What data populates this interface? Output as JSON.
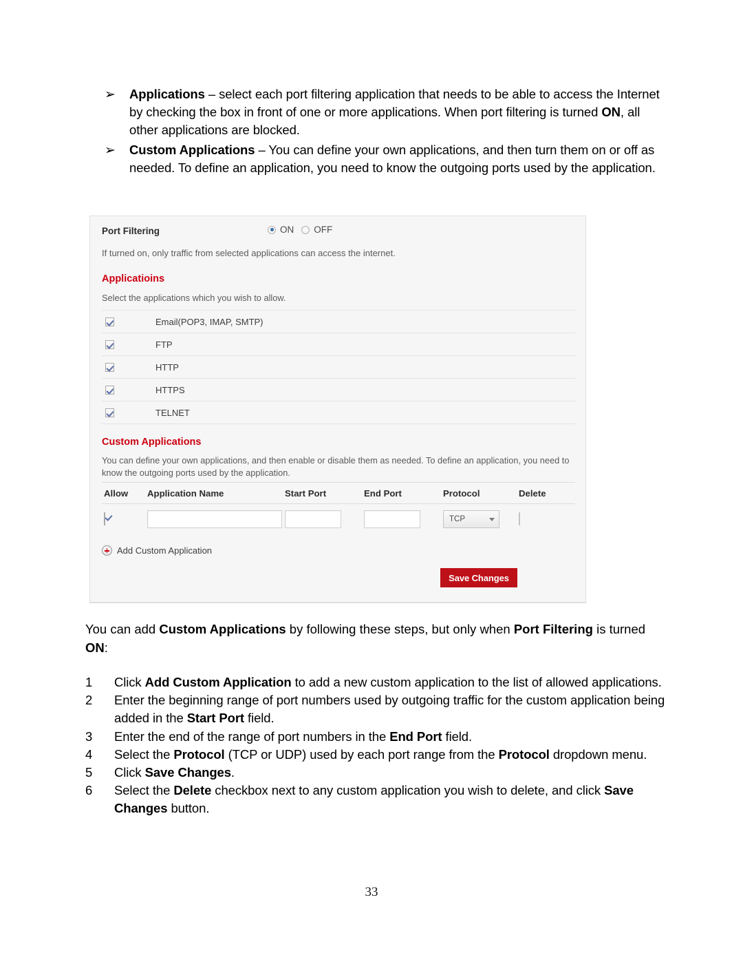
{
  "document": {
    "page_number": "33",
    "intro_bullets": [
      {
        "marker": "➢",
        "segments": [
          {
            "text": "Applications",
            "bold": true
          },
          {
            "text": " – select each port filtering application that needs to be able to access the Internet by checking the box in front of one or more applications. When port filtering is turned ",
            "bold": false
          },
          {
            "text": "ON",
            "bold": true
          },
          {
            "text": ", all other applications are blocked.",
            "bold": false
          }
        ]
      },
      {
        "marker": "➢",
        "segments": [
          {
            "text": "Custom Applications",
            "bold": true
          },
          {
            "text": " – You can define your own applications, and then turn them on or off as needed. To define an application, you need to know the outgoing ports used by the application.",
            "bold": false
          }
        ]
      }
    ],
    "paragraph_after": [
      {
        "text": "You can add ",
        "bold": false
      },
      {
        "text": "Custom Applications",
        "bold": true
      },
      {
        "text": " by following these steps, but only when ",
        "bold": false
      },
      {
        "text": "Port Filtering",
        "bold": true
      },
      {
        "text": " is turned ",
        "bold": false
      },
      {
        "text": "ON",
        "bold": true
      },
      {
        "text": ":",
        "bold": false
      }
    ],
    "steps": [
      {
        "number": "1",
        "segments": [
          {
            "text": "Click ",
            "bold": false
          },
          {
            "text": "Add Custom Application",
            "bold": true
          },
          {
            "text": " to add a new custom application to the list of allowed applications.",
            "bold": false
          }
        ]
      },
      {
        "number": "2",
        "segments": [
          {
            "text": "Enter the beginning range of port numbers used by outgoing traffic for the custom application being added in the ",
            "bold": false
          },
          {
            "text": "Start Port",
            "bold": true
          },
          {
            "text": " field.",
            "bold": false
          }
        ]
      },
      {
        "number": "3",
        "segments": [
          {
            "text": "Enter the end of the range of port numbers in the ",
            "bold": false
          },
          {
            "text": "End Port",
            "bold": true
          },
          {
            "text": " field.",
            "bold": false
          }
        ]
      },
      {
        "number": "4",
        "segments": [
          {
            "text": "Select the ",
            "bold": false
          },
          {
            "text": "Protocol",
            "bold": true
          },
          {
            "text": " (TCP or UDP) used by each port range from the ",
            "bold": false
          },
          {
            "text": "Protocol",
            "bold": true
          },
          {
            "text": " dropdown menu.",
            "bold": false
          }
        ]
      },
      {
        "number": "5",
        "segments": [
          {
            "text": "Click ",
            "bold": false
          },
          {
            "text": "Save Changes",
            "bold": true
          },
          {
            "text": ".",
            "bold": false
          }
        ]
      },
      {
        "number": "6",
        "segments": [
          {
            "text": "Select the ",
            "bold": false
          },
          {
            "text": "Delete",
            "bold": true
          },
          {
            "text": " checkbox next to any custom application you wish to delete, and click ",
            "bold": false
          },
          {
            "text": "Save Changes",
            "bold": true
          },
          {
            "text": " button.",
            "bold": false
          }
        ]
      }
    ]
  },
  "ui_panel": {
    "port_filtering": {
      "label": "Port Filtering",
      "options": [
        {
          "label": "ON",
          "selected": true
        },
        {
          "label": "OFF",
          "selected": false
        }
      ],
      "hint": "If turned on, only traffic from selected applications can access the internet."
    },
    "applications_section": {
      "heading": "Applicatioins",
      "subtext": "Select the applications which you wish to allow.",
      "items": [
        {
          "name": "Email(POP3, IMAP, SMTP)",
          "checked": true
        },
        {
          "name": "FTP",
          "checked": true
        },
        {
          "name": "HTTP",
          "checked": true
        },
        {
          "name": "HTTPS",
          "checked": true
        },
        {
          "name": "TELNET",
          "checked": true
        }
      ]
    },
    "custom_applications_section": {
      "heading": "Custom Applications",
      "subtext": "You can define your own applications, and then enable or disable them as needed. To define an application, you need to know the outgoing ports used by the application.",
      "columns": [
        "Allow",
        "Application Name",
        "Start Port",
        "End Port",
        "Protocol",
        "Delete"
      ],
      "rows": [
        {
          "allow_checked": true,
          "application_name": "",
          "start_port": "",
          "end_port": "",
          "protocol": "TCP",
          "delete_checked": false
        }
      ],
      "add_link_label": "Add Custom Application",
      "save_button_label": "Save Changes"
    },
    "colors": {
      "accent_red": "#cc0011",
      "button_red": "#be1018",
      "panel_background": "#f6f6f6",
      "panel_border": "#e0e0e0"
    }
  }
}
